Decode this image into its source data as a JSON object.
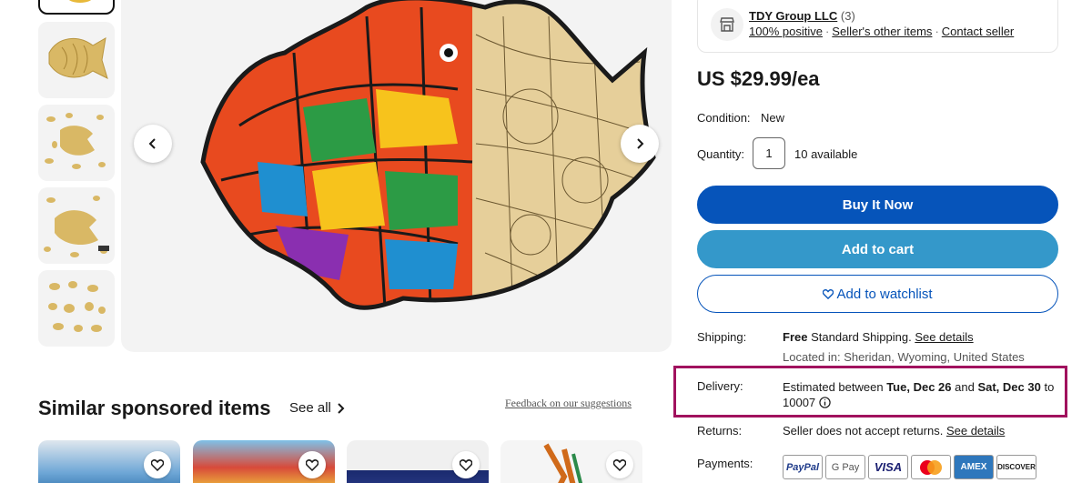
{
  "seller": {
    "name": "TDY Group LLC",
    "count": "(3)",
    "positive": "100% positive",
    "other_items": "Seller's other items",
    "contact": "Contact seller"
  },
  "price": "US $29.99/ea",
  "condition": {
    "label": "Condition:",
    "value": "New"
  },
  "quantity": {
    "label": "Quantity:",
    "value": "1",
    "available": "10 available"
  },
  "buttons": {
    "buy": "Buy It Now",
    "cart": "Add to cart",
    "watch": "Add to watchlist"
  },
  "shipping": {
    "label": "Shipping:",
    "free": "Free",
    "method": "Standard Shipping.",
    "details": "See details",
    "location": "Located in: Sheridan, Wyoming, United States"
  },
  "delivery": {
    "label": "Delivery:",
    "prefix": "Estimated between",
    "start": "Tue, Dec 26",
    "and": "and",
    "end": "Sat, Dec 30",
    "to": "to 10007"
  },
  "returns": {
    "label": "Returns:",
    "text": "Seller does not accept returns.",
    "details": "See details"
  },
  "payments": {
    "label": "Payments:",
    "methods": [
      "PayPal",
      "G Pay",
      "VISA",
      "Mastercard",
      "AMEX",
      "DISCOVER"
    ]
  },
  "similar": {
    "title": "Similar sponsored items",
    "see_all": "See all",
    "feedback": "Feedback on our suggestions"
  },
  "colors": {
    "buy_button": "#0654ba",
    "cart_button": "#3498ca",
    "highlight_box": "#a1125e"
  }
}
